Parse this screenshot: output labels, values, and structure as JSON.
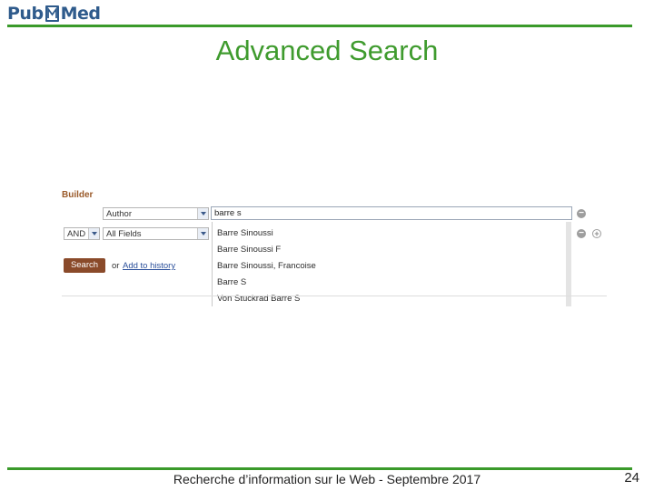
{
  "logo": {
    "text_left": "Pub",
    "text_right": "Med"
  },
  "slide": {
    "title": "Advanced Search"
  },
  "builder": {
    "label": "Builder",
    "row1": {
      "field": "Author",
      "query": "barre s"
    },
    "row2": {
      "operator": "AND",
      "field": "All Fields"
    },
    "autocomplete": [
      "Barre Sinoussi",
      "Barre Sinoussi F",
      "Barre Sinoussi, Francoise",
      "Barre S",
      "Von Stuckrad Barre S"
    ],
    "search_label": "Search",
    "or_text": "or",
    "add_history_label": "Add to history"
  },
  "footer": {
    "text": "Recherche d’information sur le Web - Septembre 2017",
    "page": "24"
  },
  "colors": {
    "accent_green": "#3a9a2a",
    "title_green": "#3f9b2e",
    "search_button": "#8a4a2a",
    "link": "#2a4f9a"
  },
  "icons": {
    "remove": "minus-circle-icon",
    "add": "plus-circle-icon",
    "dropdown": "chevron-down-icon"
  }
}
